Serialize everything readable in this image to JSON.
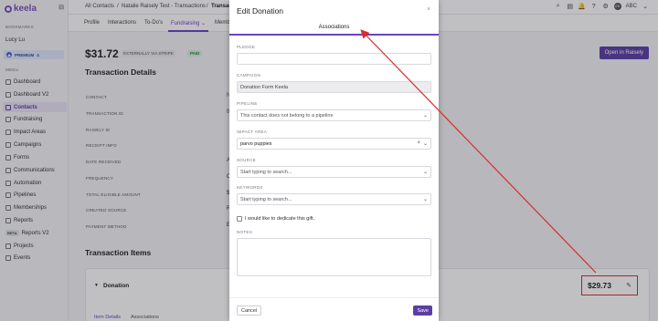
{
  "colors": {
    "brand": "#6a42c2",
    "annotation": "#d82b2b",
    "paid": "#2d7a3e"
  },
  "sidebar": {
    "logo": "keela",
    "bookmarks_label": "BOOKMARKS",
    "bookmark_user": "Lucy Lu",
    "premium_label": "PREMIUM",
    "premium_count": "4",
    "menu_label": "MENU",
    "items": [
      {
        "label": "Dashboard"
      },
      {
        "label": "Dashboard V2"
      },
      {
        "label": "Contacts"
      },
      {
        "label": "Fundraising"
      },
      {
        "label": "Impact Areas"
      },
      {
        "label": "Campaigns"
      },
      {
        "label": "Forms"
      },
      {
        "label": "Communications"
      },
      {
        "label": "Automation"
      },
      {
        "label": "Pipelines"
      },
      {
        "label": "Memberships"
      },
      {
        "label": "Reports"
      },
      {
        "label": "Reports V2",
        "badge": "BETA"
      },
      {
        "label": "Projects"
      },
      {
        "label": "Events"
      }
    ]
  },
  "topbar": {
    "crumb1": "All Contacts",
    "crumb2": "Natalie Raisely Test - Transactions",
    "crumb3": "Transac",
    "user": "ABC",
    "avatar_initials": "EB"
  },
  "tabs": [
    "Profile",
    "Interactions",
    "To-Do's",
    "Fundraising",
    "Memb"
  ],
  "main": {
    "amount": "$31.72",
    "external_badge": "EXTERNALLY VIA STRIPE",
    "paid_badge": "PAID",
    "open_button": "Open in Raisely",
    "details_title": "Transaction Details",
    "fields": [
      {
        "label": "CONTACT",
        "value": "N"
      },
      {
        "label": "TRANSACTION ID",
        "value": "0"
      },
      {
        "label": "RAISELY ID",
        "value": ""
      },
      {
        "label": "RECEIPT INFO",
        "value": ""
      },
      {
        "label": "DATE RECEIVED",
        "value": "A"
      },
      {
        "label": "FREQUENCY",
        "value": "C"
      },
      {
        "label": "TOTAL ELIGIBLE AMOUNT",
        "value": "$"
      },
      {
        "label": "CREATED SOURCE",
        "value": "R"
      },
      {
        "label": "PAYMENT METHOD",
        "value": "E"
      }
    ],
    "items_title": "Transaction Items",
    "donation_label": "Donation",
    "donation_amount": "$29.73",
    "sub_tabs": [
      "Item Details",
      "Associations"
    ]
  },
  "modal": {
    "title": "Edit Donation",
    "close": "×",
    "tab": "Associations",
    "pledge_label": "PLEDGE",
    "pledge_value": "",
    "campaign_label": "CAMPAIGN",
    "campaign_value": "Donation Form Keela",
    "pipeline_label": "PIPELINE",
    "pipeline_placeholder": "This contact does not belong to a pipeline",
    "impact_label": "IMPACT AREA",
    "impact_value": "parvo puppies",
    "source_label": "SOURCE",
    "source_placeholder": "Start typing to search...",
    "keywords_label": "KEYWORDS",
    "keywords_placeholder": "Start typing to search...",
    "dedicate_label": "I would like to dedicate this gift.",
    "notes_label": "NOTES",
    "cancel": "Cancel",
    "save": "Save"
  }
}
